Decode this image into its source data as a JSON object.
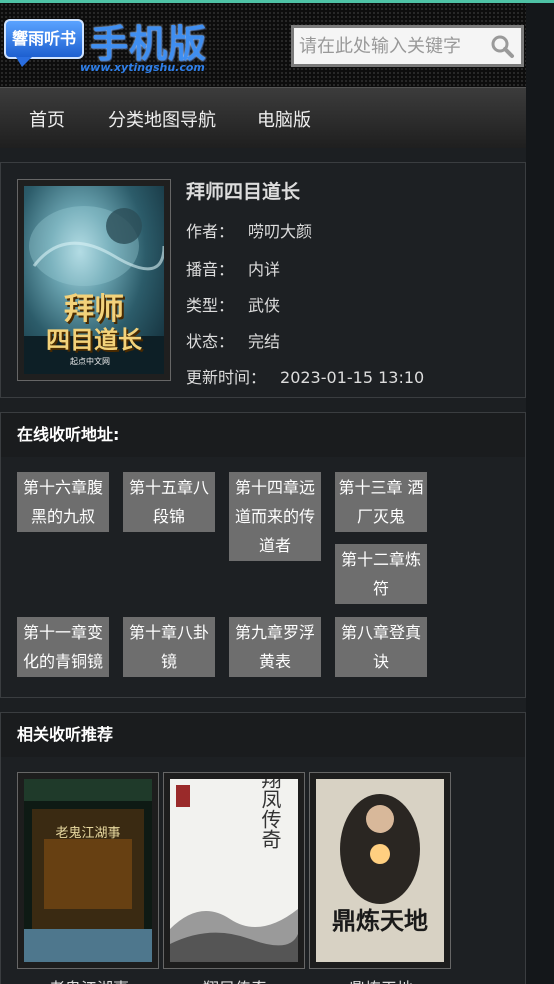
{
  "site": {
    "logo_badge": "響雨听书",
    "logo_title": "手机版",
    "logo_url": "www.xytingshu.com"
  },
  "search": {
    "placeholder": "请在此处输入关键字",
    "icon": "search-icon"
  },
  "nav": {
    "items": [
      {
        "label": "首页"
      },
      {
        "label": "分类地图导航"
      },
      {
        "label": "电脑版"
      }
    ]
  },
  "book": {
    "title": "拜师四目道长",
    "cover_text_line1": "拜师",
    "cover_text_line2": "四目道长",
    "cover_publisher": "起点中文网",
    "author_label": "作者：",
    "author": "唠叨大颜",
    "narrator_label": "播音：",
    "narrator": "内详",
    "type_label": "类型：",
    "type": "武侠",
    "status_label": "状态：",
    "status": "完结",
    "updated_label": "更新时间：",
    "updated": "2023-01-15 13:10"
  },
  "listen": {
    "heading": "在线收听地址:",
    "chapters": [
      {
        "label": "第十六章腹黑的九叔"
      },
      {
        "label": "第十五章八段锦"
      },
      {
        "label": "第十四章远道而来的传道者"
      },
      {
        "label": "第十三章 酒厂灭鬼"
      },
      {
        "label": "第十二章炼符"
      },
      {
        "label": "第十一章变化的青铜镜"
      },
      {
        "label": "第十章八卦镜"
      },
      {
        "label": "第九章罗浮黄表"
      },
      {
        "label": "第八章登真诀"
      }
    ]
  },
  "recommend": {
    "heading": "相关收听推荐",
    "items": [
      {
        "title": "老鬼江湖事",
        "cover_text": "老鬼江湖事"
      },
      {
        "title": "翔凤传奇",
        "cover_text": "翔凤传奇"
      },
      {
        "title": "鼎炼天地",
        "cover_text": "鼎炼天地"
      }
    ]
  },
  "colors": {
    "accent": "#4ec2a5",
    "logo_blue": "#3f8ef0",
    "chapter_bg": "#6e6e6e",
    "page_bg": "#1c1f22"
  }
}
